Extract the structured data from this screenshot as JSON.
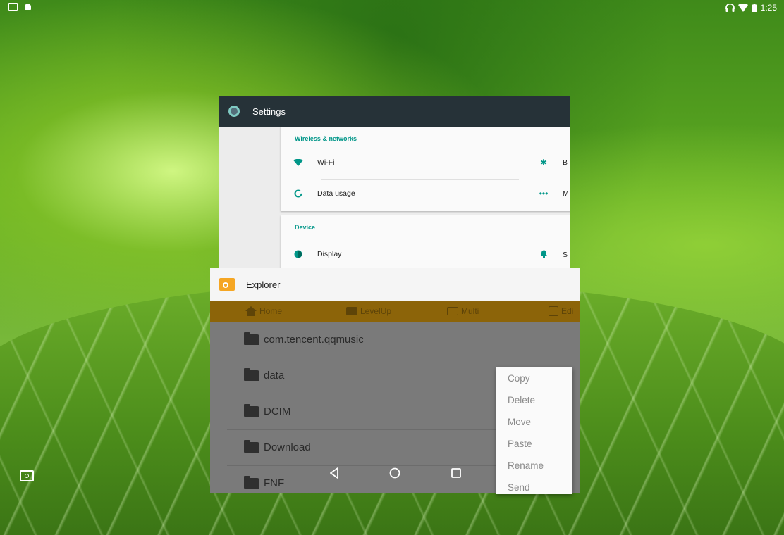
{
  "status_bar": {
    "time": "1:25",
    "left_icons": [
      "screenshot-icon",
      "android-icon"
    ],
    "right_icons": [
      "headset-icon",
      "wifi-icon",
      "battery-icon"
    ]
  },
  "settings_card": {
    "title": "Settings",
    "sections": [
      {
        "header": "Wireless & networks",
        "left_items": [
          {
            "label": "Wi-Fi",
            "icon": "wifi-icon"
          },
          {
            "label": "Data usage",
            "icon": "data-usage-icon"
          }
        ],
        "right_items": [
          {
            "label": "B",
            "icon": "bluetooth-icon"
          },
          {
            "label": "M",
            "icon": "more-icon"
          }
        ]
      },
      {
        "header": "Device",
        "left_items": [
          {
            "label": "Display",
            "icon": "display-icon"
          }
        ],
        "right_items": [
          {
            "label": "S",
            "icon": "notification-icon"
          }
        ]
      }
    ]
  },
  "explorer_card": {
    "title": "Explorer",
    "toolbar": {
      "home": "Home",
      "levelup": "LevelUp",
      "multi": "Multi",
      "edit": "Edi"
    },
    "files": [
      "com.tencent.qqmusic",
      "data",
      "DCIM",
      "Download",
      "FNF"
    ]
  },
  "context_menu": {
    "items": [
      "Copy",
      "Delete",
      "Move",
      "Paste",
      "Rename",
      "Send"
    ]
  },
  "nav_bar": {
    "icons": [
      "back-icon",
      "home-icon",
      "recents-icon"
    ]
  },
  "colors": {
    "settings_header": "#263238",
    "settings_accent": "#009688",
    "explorer_toolbar": "#8c6409",
    "explorer_icon": "#f5a623"
  }
}
